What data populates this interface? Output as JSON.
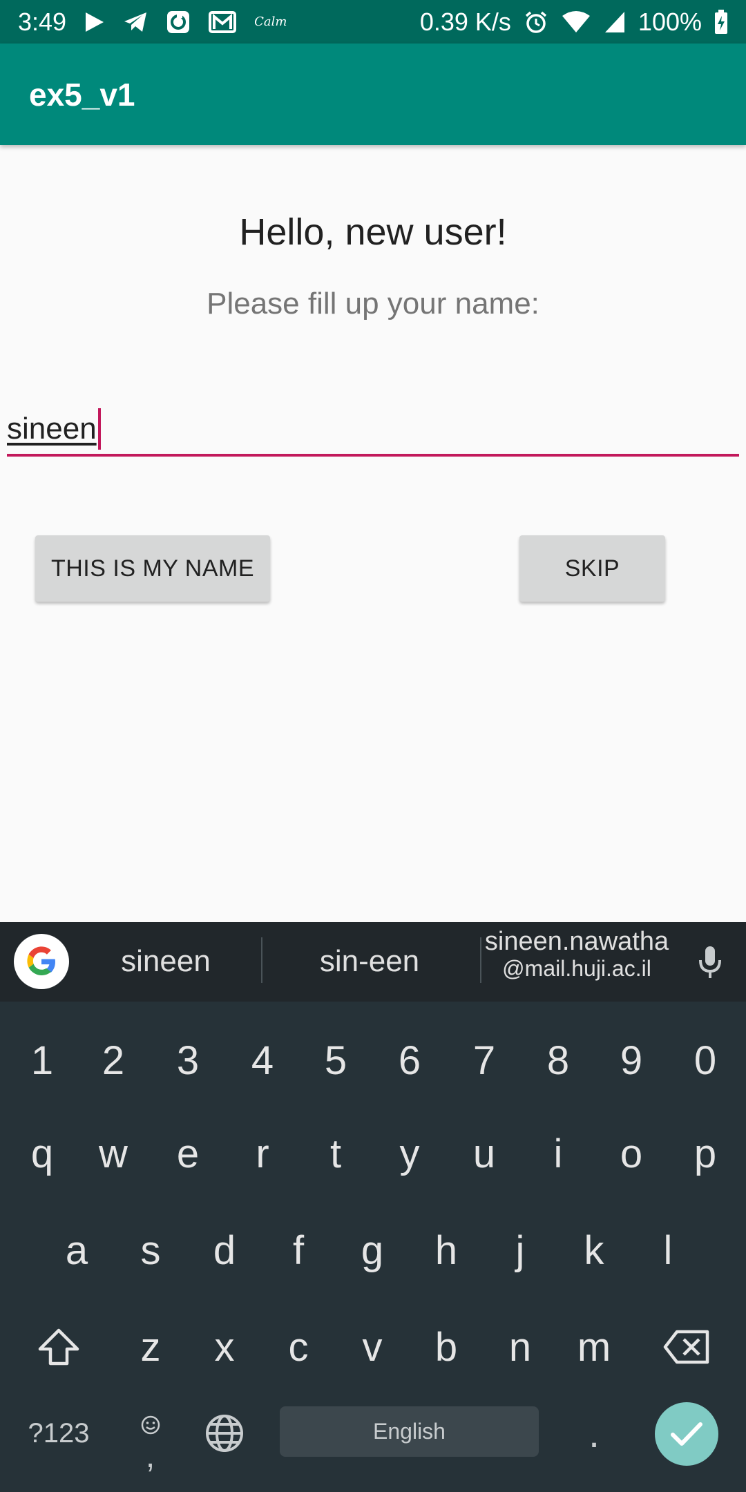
{
  "status_bar": {
    "time": "3:49",
    "calm_label": "Calm",
    "net_speed": "0.39 K/s",
    "battery": "100%"
  },
  "app_bar": {
    "title": "ex5_v1"
  },
  "main": {
    "greeting": "Hello, new user!",
    "subtitle": "Please fill up your name:",
    "name_input_value": "sineen",
    "confirm_button": "THIS IS MY NAME",
    "skip_button": "SKIP"
  },
  "keyboard": {
    "suggestions": [
      "sineen",
      "sin-een"
    ],
    "email_suggestion_line1": "sineen.nawatha",
    "email_suggestion_line2": "@mail.huji.ac.il",
    "row_numbers": [
      "1",
      "2",
      "3",
      "4",
      "5",
      "6",
      "7",
      "8",
      "9",
      "0"
    ],
    "row_1": [
      "q",
      "w",
      "e",
      "r",
      "t",
      "y",
      "u",
      "i",
      "o",
      "p"
    ],
    "row_2": [
      "a",
      "s",
      "d",
      "f",
      "g",
      "h",
      "j",
      "k",
      "l"
    ],
    "row_3": [
      "z",
      "x",
      "c",
      "v",
      "b",
      "n",
      "m"
    ],
    "symbols_key": "?123",
    "comma_key": ",",
    "space_label": "English",
    "period_key": "."
  },
  "colors": {
    "status_bar": "#00695c",
    "app_bar": "#00897b",
    "accent": "#c2185b",
    "keyboard_bg": "#263238",
    "enter_key": "#80cbc4"
  }
}
